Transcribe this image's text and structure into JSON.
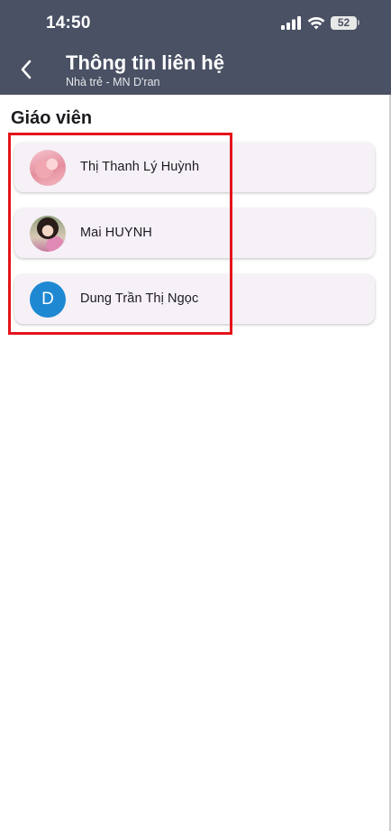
{
  "status_bar": {
    "time": "14:50",
    "battery": "52"
  },
  "header": {
    "title": "Thông tin liên hệ",
    "subtitle": "Nhà trẻ - MN D'ran",
    "background_color": "#4a5164"
  },
  "section": {
    "title": "Giáo viên"
  },
  "contacts": [
    {
      "name": "Thị Thanh Lý Huỳnh",
      "avatar": "photo"
    },
    {
      "name": "Mai HUYNH",
      "avatar": "photo"
    },
    {
      "name": "Dung Trần Thị Ngọc",
      "avatar": "letter",
      "initial": "D",
      "avatar_color": "#1e88d2"
    }
  ],
  "highlight_color": "#e3151a"
}
